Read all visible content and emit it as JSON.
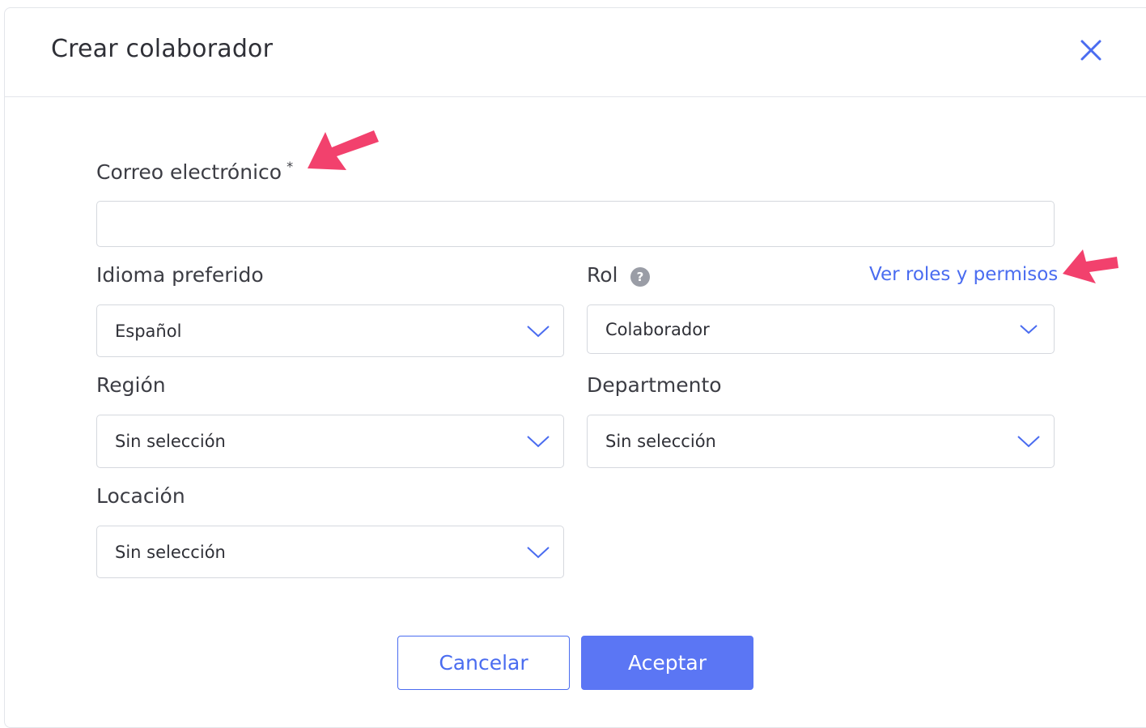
{
  "modal": {
    "title": "Crear colaborador"
  },
  "form": {
    "email": {
      "label": "Correo electrónico",
      "required_mark": "*",
      "value": "",
      "placeholder": ""
    },
    "language": {
      "label": "Idioma preferido",
      "selected": "Español"
    },
    "role": {
      "label": "Rol",
      "help_icon": "question-circle-icon",
      "link_label": "Ver roles y permisos",
      "selected": "Colaborador"
    },
    "region": {
      "label": "Región",
      "selected": "Sin selección"
    },
    "department": {
      "label": "Departmento",
      "selected": "Sin selección"
    },
    "location": {
      "label": "Locación",
      "selected": "Sin selección"
    }
  },
  "actions": {
    "cancel_label": "Cancelar",
    "accept_label": "Aceptar"
  },
  "colors": {
    "accent": "#4a6cf0",
    "primary_button": "#5b76f4",
    "annotation_arrow": "#f2416d"
  }
}
